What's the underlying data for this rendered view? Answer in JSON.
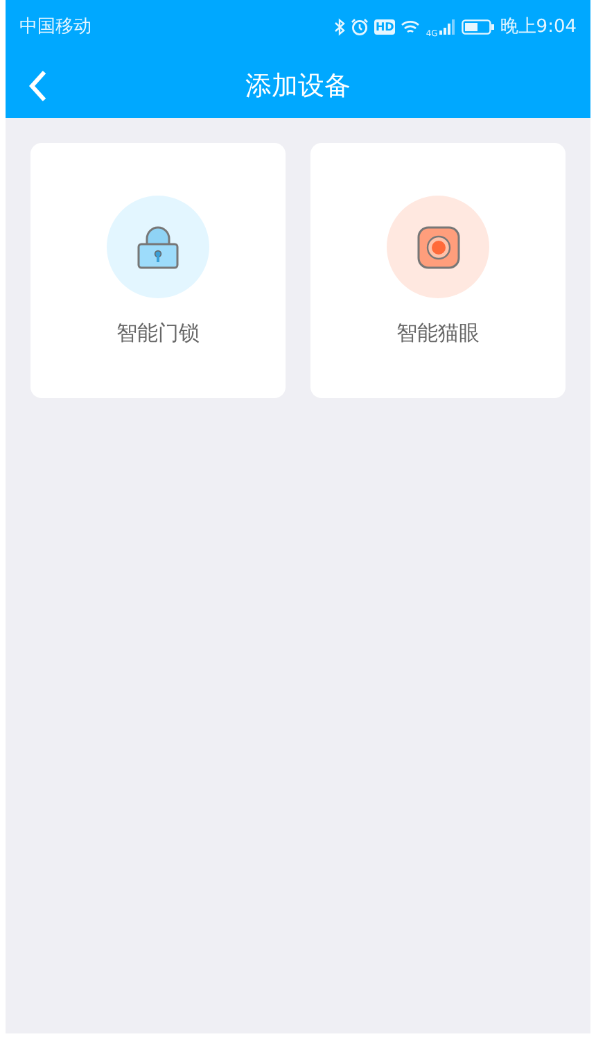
{
  "status_bar": {
    "carrier": "中国移动",
    "hd_badge": "HD",
    "network_type": "4G",
    "time": "晚上9:04"
  },
  "nav_bar": {
    "title": "添加设备"
  },
  "devices": [
    {
      "kind": "lock",
      "label": "智能门锁"
    },
    {
      "kind": "peephole",
      "label": "智能猫眼"
    }
  ]
}
